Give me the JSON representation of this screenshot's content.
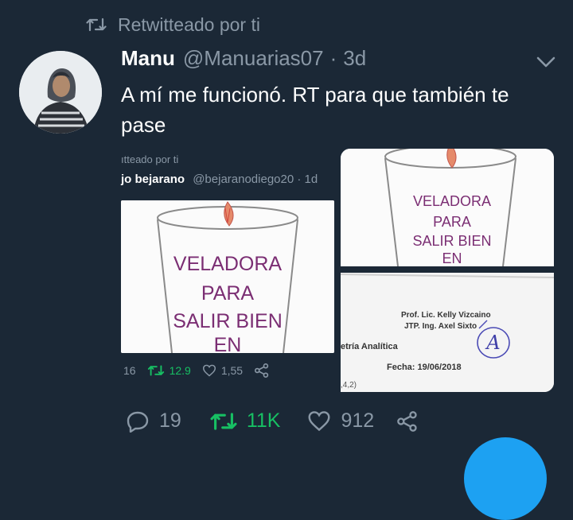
{
  "retweet_header": {
    "label": "Retwitteado por ti",
    "icon": "retweet-icon"
  },
  "tweet": {
    "author_name": "Manu",
    "author_handle": "@Manuarias07",
    "separator": "·",
    "time": "3d",
    "text": "A mí me funcionó. RT para que también te pase",
    "menu_icon": "chevron-down-icon"
  },
  "quoted_tweet": {
    "retweet_label": "ıtteado por ti",
    "author_name": "jo bejarano",
    "author_handle": "@bejaranodiego20",
    "separator": "·",
    "time": "1d",
    "card_text": [
      "VELADORA",
      "PARA",
      "SALIR BIEN",
      "EN"
    ],
    "actions": {
      "replies": "16",
      "retweets": "12.9",
      "likes": "1,55"
    }
  },
  "side_media": {
    "card_text": [
      "VELADORA",
      "PARA",
      "SALIR BIEN",
      "EN"
    ],
    "document": {
      "line_prof": "Prof. Lic. Kelly Vizcaino",
      "line_jtp": "JTP. Ing. Axel Sixto",
      "subject": "etría Analítica",
      "date": "Fecha: 19/06/2018",
      "grade": "A",
      "fragment": ",4,2)"
    }
  },
  "actions": {
    "replies": "19",
    "retweets": "11K",
    "likes": "912"
  },
  "colors": {
    "background": "#1b2836",
    "muted": "#8a98a6",
    "retweet_green": "#17bf63",
    "fab_blue": "#1da1f2",
    "card_purple": "#7b2e73"
  }
}
